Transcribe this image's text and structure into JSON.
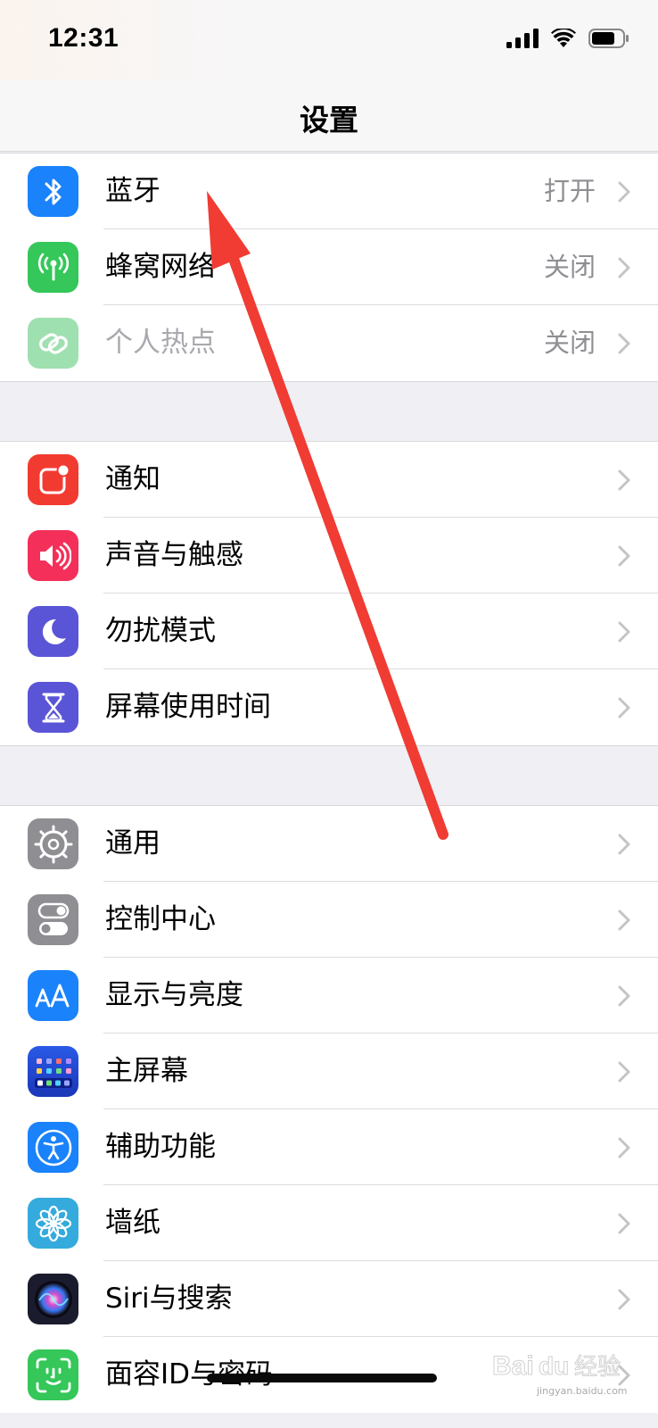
{
  "status_bar": {
    "time": "12:31"
  },
  "nav": {
    "title": "设置"
  },
  "groups": [
    {
      "items": [
        {
          "label": "蓝牙",
          "value": "打开",
          "icon": "bluetooth-icon",
          "color": "#1a82fb"
        },
        {
          "label": "蜂窝网络",
          "value": "关闭",
          "icon": "cellular-antenna-icon",
          "color": "#35c759"
        },
        {
          "label": "个人热点",
          "value": "关闭",
          "icon": "hotspot-link-icon",
          "color": "#9fe0b0",
          "disabled": true
        }
      ]
    },
    {
      "items": [
        {
          "label": "通知",
          "icon": "notification-icon",
          "color": "#f23b30"
        },
        {
          "label": "声音与触感",
          "icon": "speaker-icon",
          "color": "#f4305a"
        },
        {
          "label": "勿扰模式",
          "icon": "moon-icon",
          "color": "#5a55d6"
        },
        {
          "label": "屏幕使用时间",
          "icon": "hourglass-icon",
          "color": "#5a55d6"
        }
      ]
    },
    {
      "items": [
        {
          "label": "通用",
          "icon": "gear-icon",
          "color": "#8e8e93"
        },
        {
          "label": "控制中心",
          "icon": "toggle-switches-icon",
          "color": "#8e8e93"
        },
        {
          "label": "显示与亮度",
          "icon": "text-size-aa-icon",
          "color": "#1a82fb"
        },
        {
          "label": "主屏幕",
          "icon": "home-screen-grid-icon",
          "color": "#2a4fd8"
        },
        {
          "label": "辅助功能",
          "icon": "accessibility-person-icon",
          "color": "#1a82fb"
        },
        {
          "label": "墙纸",
          "icon": "flower-icon",
          "color": "#35aadc"
        },
        {
          "label": "Siri与搜索",
          "icon": "siri-orb-icon",
          "color": "#1b1b2e"
        },
        {
          "label": "面容ID与密码",
          "icon": "face-id-icon",
          "color": "#35c759"
        }
      ]
    }
  ],
  "annotation": {
    "arrow_color": "#f03c33"
  },
  "watermark": {
    "brand": "Baidu经验",
    "url": "jingyan.baidu.com"
  }
}
